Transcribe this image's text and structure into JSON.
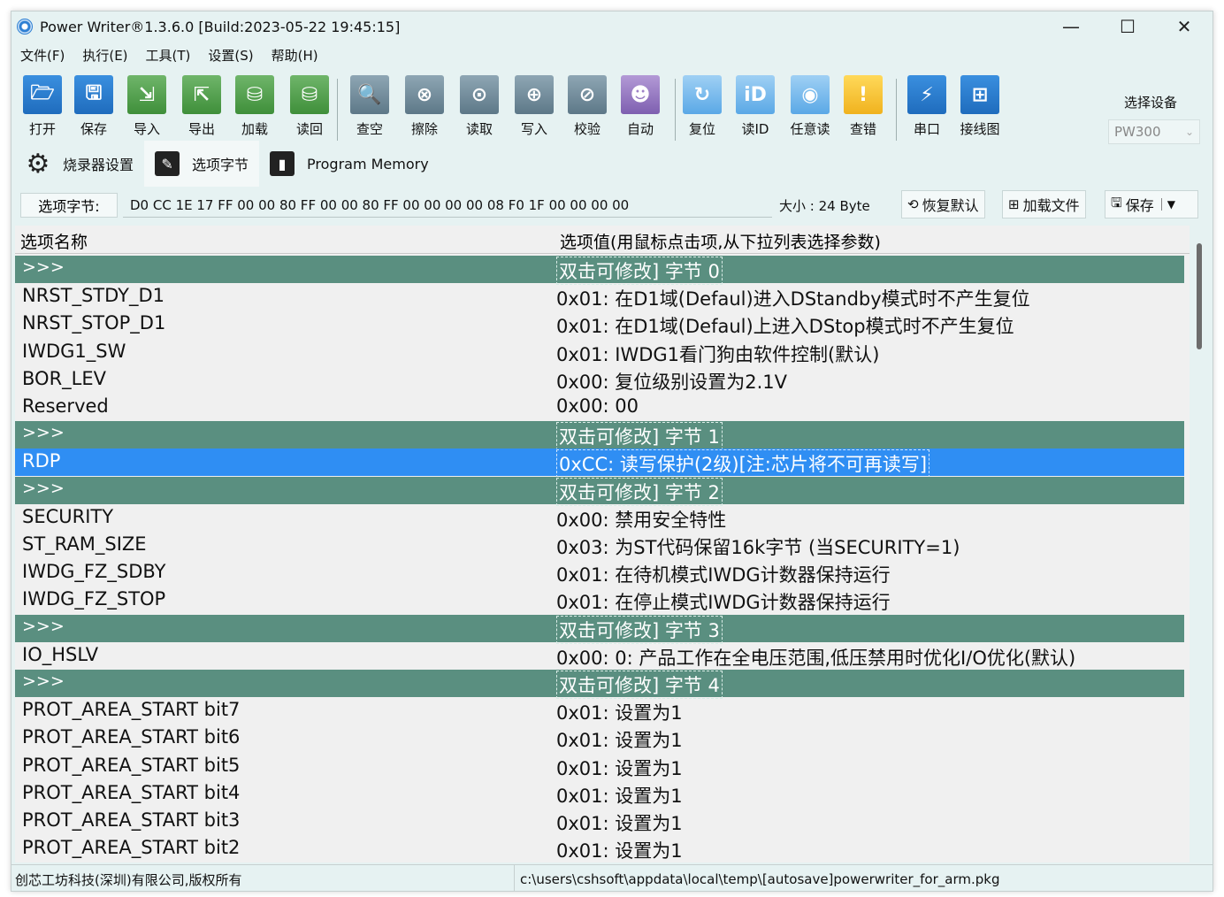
{
  "window": {
    "title": "Power Writer®1.3.6.0 [Build:2023-05-22 19:45:15]",
    "minimize": "—",
    "maximize": "☐",
    "close": "✕"
  },
  "menu": [
    "文件(F)",
    "执行(E)",
    "工具(T)",
    "设置(S)",
    "帮助(H)"
  ],
  "toolbar": {
    "items": [
      {
        "label": "打开",
        "icon": "folder-open-icon",
        "glyph": "🗁",
        "color": "blue"
      },
      {
        "label": "保存",
        "icon": "save-icon",
        "glyph": "🖫",
        "color": "blue"
      },
      {
        "label": "导入",
        "icon": "import-icon",
        "glyph": "⇲",
        "color": "green"
      },
      {
        "label": "导出",
        "icon": "export-icon",
        "glyph": "⇱",
        "color": "green"
      },
      {
        "label": "加载",
        "icon": "load-icon",
        "glyph": "⛁",
        "color": "green"
      },
      {
        "label": "读回",
        "icon": "readback-icon",
        "glyph": "⛁",
        "color": "green"
      },
      {
        "label": "查空",
        "icon": "blank-check-icon",
        "glyph": "🔍",
        "color": "gray"
      },
      {
        "label": "擦除",
        "icon": "erase-icon",
        "glyph": "⊗",
        "color": "gray"
      },
      {
        "label": "读取",
        "icon": "read-icon",
        "glyph": "⊙",
        "color": "gray"
      },
      {
        "label": "写入",
        "icon": "write-icon",
        "glyph": "⊕",
        "color": "gray"
      },
      {
        "label": "校验",
        "icon": "verify-icon",
        "glyph": "⊘",
        "color": "gray"
      },
      {
        "label": "自动",
        "icon": "robot-icon",
        "glyph": "☻",
        "color": "purple"
      },
      {
        "label": "复位",
        "icon": "reset-icon",
        "glyph": "↻",
        "color": "lblue"
      },
      {
        "label": "读ID",
        "icon": "read-id-icon",
        "glyph": "iD",
        "color": "lblue"
      },
      {
        "label": "任意读",
        "icon": "any-read-icon",
        "glyph": "◉",
        "color": "lblue"
      },
      {
        "label": "查错",
        "icon": "error-check-icon",
        "glyph": "!",
        "color": "yellow"
      },
      {
        "label": "串口",
        "icon": "serial-port-icon",
        "glyph": "⚡",
        "color": "blue"
      },
      {
        "label": "接线图",
        "icon": "wiring-diagram-icon",
        "glyph": "⊞",
        "color": "blue"
      }
    ],
    "select_device_label": "选择设备",
    "select_device_value": "PW300"
  },
  "tabs": [
    {
      "label": "烧录器设置",
      "icon": "gear-icon"
    },
    {
      "label": "选项字节",
      "icon": "option-bytes-icon"
    },
    {
      "label": "Program Memory",
      "icon": "memory-icon"
    }
  ],
  "option_bytes": {
    "label": "选项字节:",
    "value": "D0 CC 1E 17 FF 00 00 80 FF 00 00 80 FF 00 00 00 00 08 F0 1F 00 00 00 00",
    "size": "大小 : 24 Byte",
    "restore_label": "恢复默认",
    "load_file_label": "加载文件",
    "save_label": "保存"
  },
  "grid": {
    "header_name": "选项名称",
    "header_value": "选项值(用鼠标点击项,从下拉列表选择参数)",
    "rows": [
      {
        "name": ">>>",
        "value": "双击可修改] 字节 0",
        "type": "group"
      },
      {
        "name": "NRST_STDY_D1",
        "value": "0x01: 在D1域(Defaul)进入DStandby模式时不产生复位",
        "type": "item"
      },
      {
        "name": "NRST_STOP_D1",
        "value": "0x01: 在D1域(Defaul)上进入DStop模式时不产生复位",
        "type": "item"
      },
      {
        "name": "IWDG1_SW",
        "value": "0x01: IWDG1看门狗由软件控制(默认)",
        "type": "item"
      },
      {
        "name": "BOR_LEV",
        "value": "0x00: 复位级别设置为2.1V",
        "type": "item"
      },
      {
        "name": "Reserved",
        "value": "0x00: 00",
        "type": "item"
      },
      {
        "name": ">>>",
        "value": "双击可修改] 字节 1",
        "type": "group"
      },
      {
        "name": "RDP",
        "value": "0xCC: 读写保护(2级)[注:芯片将不可再读写]",
        "type": "selected"
      },
      {
        "name": ">>>",
        "value": "双击可修改] 字节 2",
        "type": "group"
      },
      {
        "name": "SECURITY",
        "value": "0x00: 禁用安全特性",
        "type": "item"
      },
      {
        "name": "ST_RAM_SIZE",
        "value": "0x03: 为ST代码保留16k字节 (当SECURITY=1)",
        "type": "item"
      },
      {
        "name": "IWDG_FZ_SDBY",
        "value": "0x01: 在待机模式IWDG计数器保持运行",
        "type": "item"
      },
      {
        "name": "IWDG_FZ_STOP",
        "value": "0x01: 在停止模式IWDG计数器保持运行",
        "type": "item"
      },
      {
        "name": ">>>",
        "value": "双击可修改] 字节 3",
        "type": "group"
      },
      {
        "name": "IO_HSLV",
        "value": "0x00: 0: 产品工作在全电压范围,低压禁用时优化I/O优化(默认)",
        "type": "item"
      },
      {
        "name": ">>>",
        "value": "双击可修改] 字节 4",
        "type": "group"
      },
      {
        "name": "PROT_AREA_START bit7",
        "value": "0x01: 设置为1",
        "type": "item"
      },
      {
        "name": "PROT_AREA_START bit6",
        "value": "0x01: 设置为1",
        "type": "item"
      },
      {
        "name": "PROT_AREA_START bit5",
        "value": "0x01: 设置为1",
        "type": "item"
      },
      {
        "name": "PROT_AREA_START bit4",
        "value": "0x01: 设置为1",
        "type": "item"
      },
      {
        "name": "PROT_AREA_START bit3",
        "value": "0x01: 设置为1",
        "type": "item"
      },
      {
        "name": "PROT_AREA_START bit2",
        "value": "0x01: 设置为1",
        "type": "item"
      }
    ]
  },
  "status": {
    "copyright": "创芯工坊科技(深圳)有限公司,版权所有",
    "path": "c:\\users\\cshsoft\\appdata\\local\\temp\\[autosave]powerwriter_for_arm.pkg"
  }
}
